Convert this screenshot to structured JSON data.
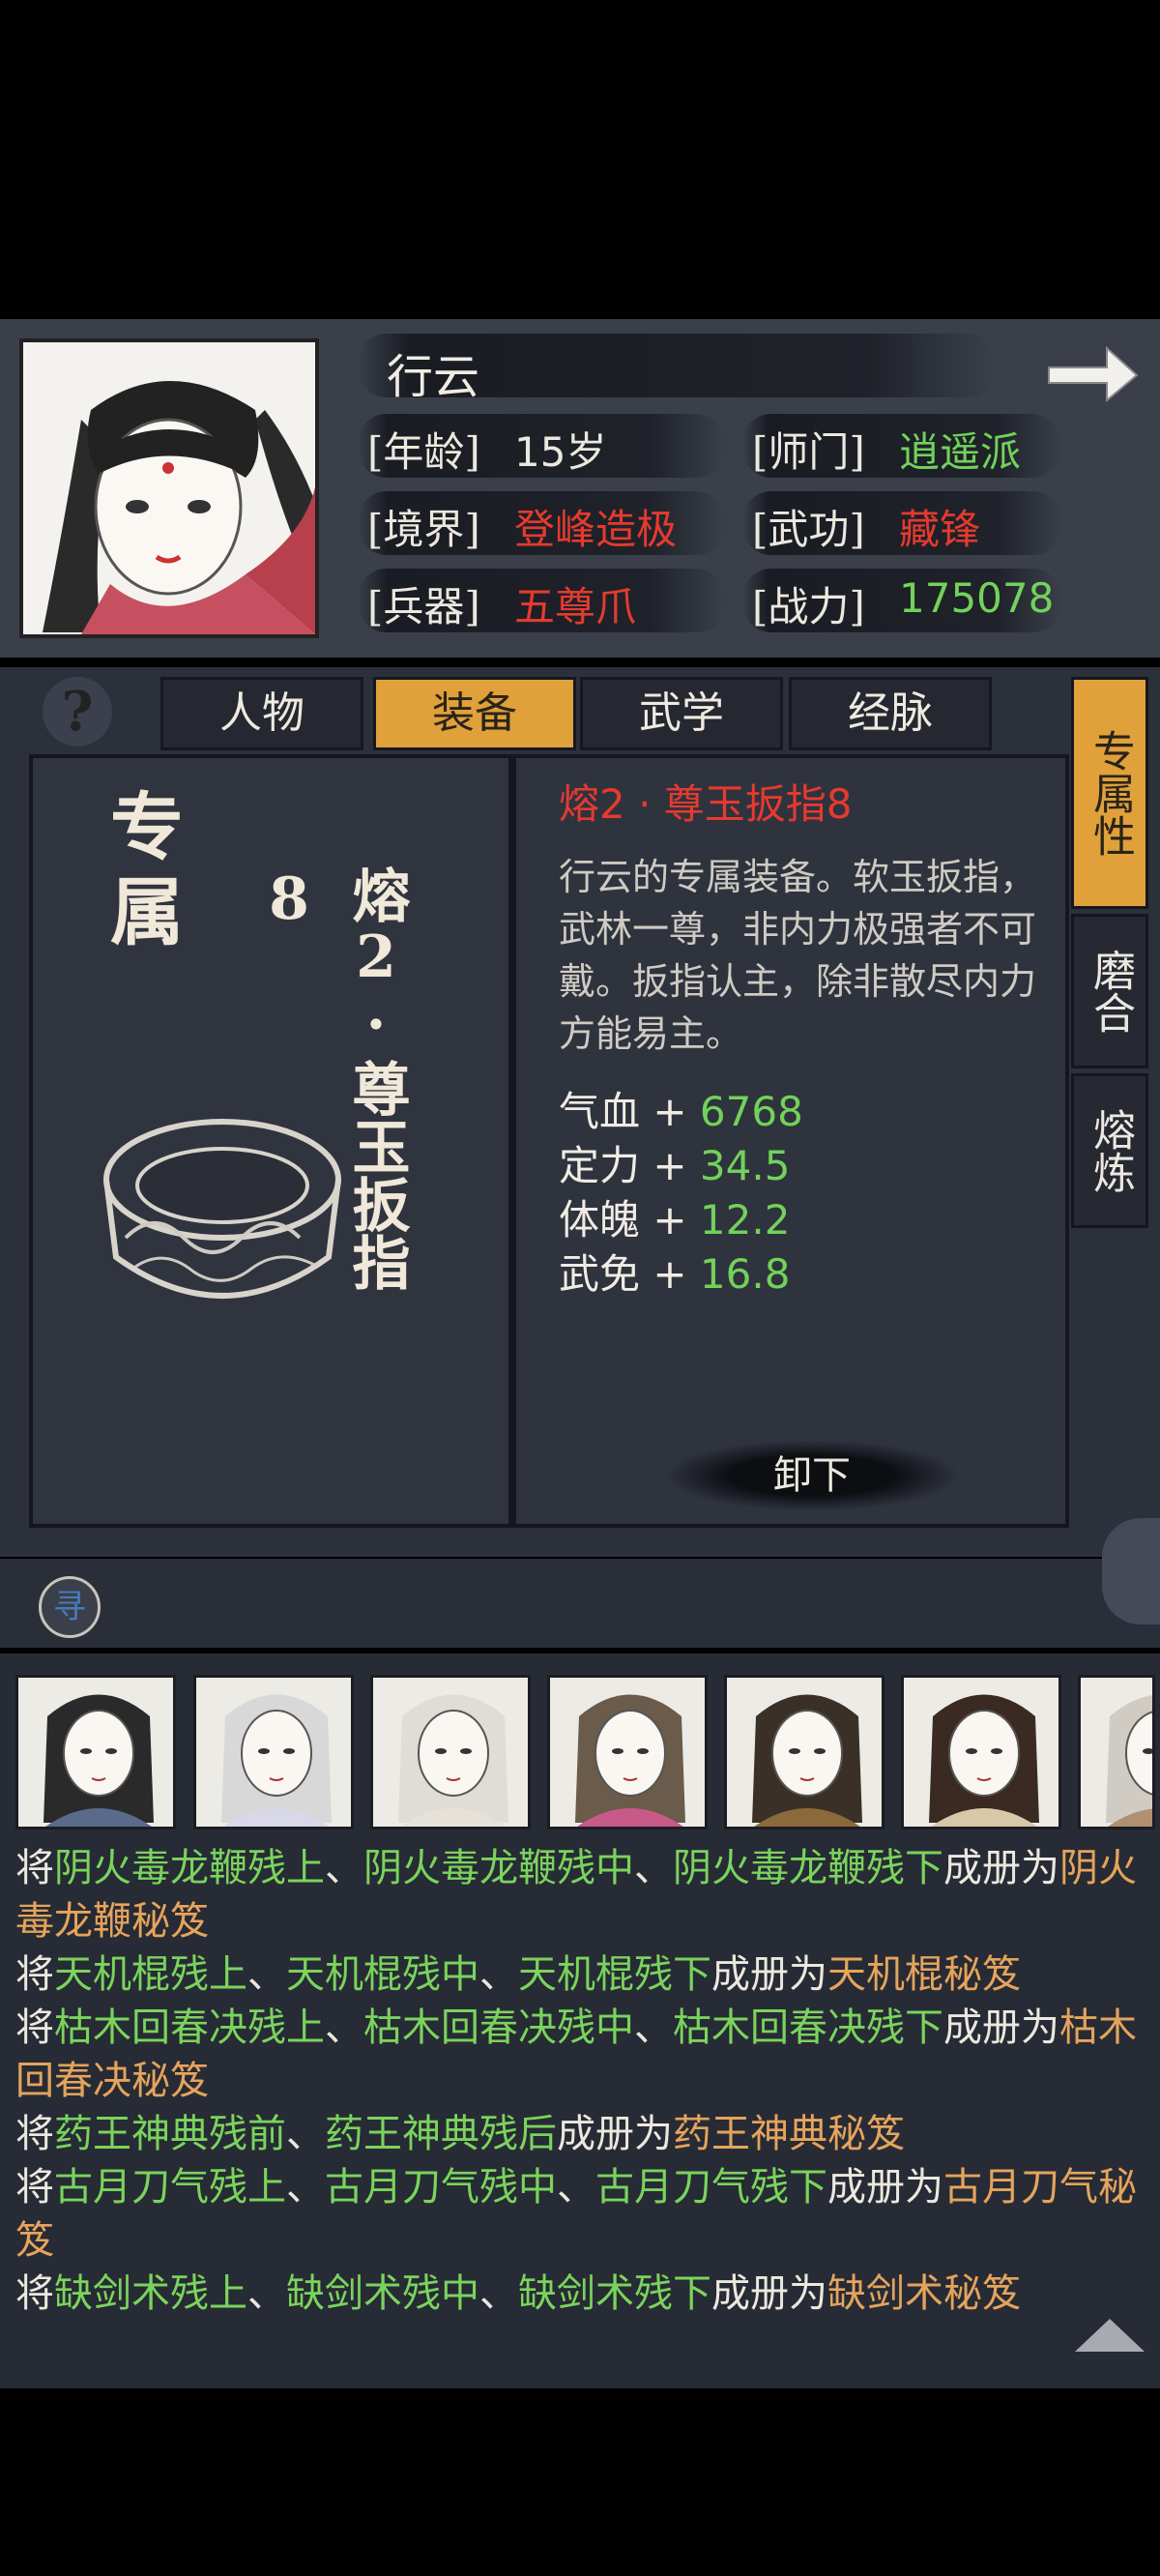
{
  "character": {
    "name": "行云",
    "rows": [
      {
        "label": "[年龄]",
        "value": "15岁",
        "color": "#ece8df"
      },
      {
        "label": "[师门]",
        "value": "逍遥派",
        "color": "#72d25a"
      },
      {
        "label": "[境界]",
        "value": "登峰造极",
        "color": "#e53a2f"
      },
      {
        "label": "[武功]",
        "value": "藏锋",
        "color": "#e53a2f"
      },
      {
        "label": "[兵器]",
        "value": "五尊爪",
        "color": "#e53a2f"
      },
      {
        "label": "[战力]",
        "value": "175078",
        "color": "#72d25a"
      }
    ]
  },
  "tabs": [
    "人物",
    "装备",
    "武学",
    "经脉"
  ],
  "active_tab": "装备",
  "side_tabs": [
    "专属性",
    "磨合",
    "熔炼"
  ],
  "active_side_tab": "专属性",
  "item": {
    "category": "专属",
    "name_vertical": "熔2·尊玉扳指8",
    "title": "熔2 · 尊玉扳指8",
    "description": "行云的专属装备。软玉扳指，武林一尊，非内力极强者不可戴。扳指认主，除非散尽内力方能易主。",
    "stats": [
      {
        "name": "气血",
        "value": "6768"
      },
      {
        "name": "定力",
        "value": "34.5"
      },
      {
        "name": "体魄",
        "value": "12.2"
      },
      {
        "name": "武免",
        "value": "16.8"
      }
    ],
    "unequip_label": "卸下"
  },
  "search_glyph": "寻",
  "help_glyph": "?",
  "log": [
    [
      [
        "",
        "将"
      ],
      [
        "g",
        "阴火毒龙鞭残上"
      ],
      [
        "",
        "、"
      ],
      [
        "g",
        "阴火毒龙鞭残中"
      ],
      [
        "",
        "、"
      ],
      [
        "g",
        "阴火毒龙鞭残下"
      ],
      [
        "",
        "成册为"
      ],
      [
        "o",
        "阴火毒龙鞭秘笈"
      ]
    ],
    [
      [
        "",
        "将"
      ],
      [
        "g",
        "天机棍残上"
      ],
      [
        "",
        "、"
      ],
      [
        "g",
        "天机棍残中"
      ],
      [
        "",
        "、"
      ],
      [
        "g",
        "天机棍残下"
      ],
      [
        "",
        "成册为"
      ],
      [
        "o",
        "天机棍秘笈"
      ]
    ],
    [
      [
        "",
        "将"
      ],
      [
        "g",
        "枯木回春决残上"
      ],
      [
        "",
        "、"
      ],
      [
        "g",
        "枯木回春决残中"
      ],
      [
        "",
        "、"
      ],
      [
        "g",
        "枯木回春决残下"
      ],
      [
        "",
        "成册为"
      ],
      [
        "o",
        "枯木回春决秘笈"
      ]
    ],
    [
      [
        "",
        "将"
      ],
      [
        "g",
        "药王神典残前"
      ],
      [
        "",
        "、"
      ],
      [
        "g",
        "药王神典残后"
      ],
      [
        "",
        "成册为"
      ],
      [
        "o",
        "药王神典秘笈"
      ]
    ],
    [
      [
        "",
        "将"
      ],
      [
        "g",
        "古月刀气残上"
      ],
      [
        "",
        "、"
      ],
      [
        "g",
        "古月刀气残中"
      ],
      [
        "",
        "、"
      ],
      [
        "g",
        "古月刀气残下"
      ],
      [
        "",
        "成册为"
      ],
      [
        "o",
        "古月刀气秘笈"
      ]
    ],
    [
      [
        "",
        "将"
      ],
      [
        "g",
        "缺剑术残上"
      ],
      [
        "",
        "、"
      ],
      [
        "g",
        "缺剑术残中"
      ],
      [
        "",
        "、"
      ],
      [
        "g",
        "缺剑术残下"
      ],
      [
        "",
        "成册为"
      ],
      [
        "o",
        "缺剑术秘笈"
      ]
    ]
  ]
}
